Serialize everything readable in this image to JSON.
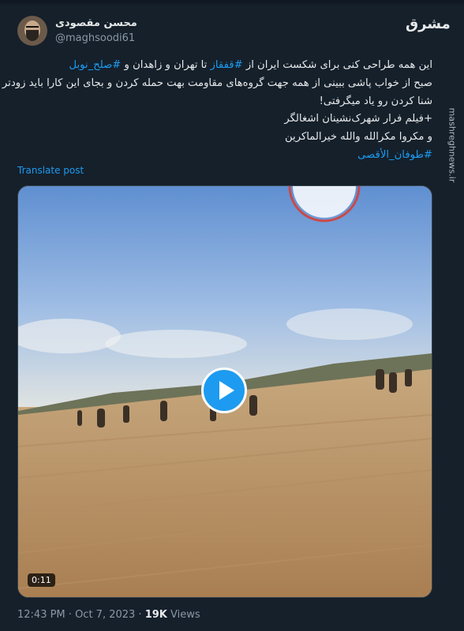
{
  "author": {
    "name": "محسن مقصودی",
    "handle": "@maghsoodi61"
  },
  "watermark": {
    "logo_text": "مشرق",
    "site": "mashreghnews.ir"
  },
  "post": {
    "line1_prefix": "این همه طراحی کنی برای شکست ایران از ",
    "line1_tag1": "#قفقاز",
    "line1_mid": " تا تهران و زاهدان و ",
    "line1_tag2": "#صلح_نوبل",
    "line2": "صبح از خواب پاشی ببینی از همه جهت گروه‌های مقاومت بهت حمله کردن و بجای این کارا باید زودتر",
    "line3": "شنا کردن رو یاد میگرفتی!",
    "line4": "+فیلم فرار شهرک‌نشینان اشغالگر",
    "line5": "و مکروا مکرالله والله خیرالماکرین",
    "tag_line": "#طوفان_الأقصی"
  },
  "translate_label": "Translate post",
  "video": {
    "duration": "0:11",
    "play_icon": "play-icon"
  },
  "meta": {
    "time": "12:43 PM",
    "separator": " · ",
    "date": "Oct 7, 2023",
    "views_count": "19K",
    "views_label": " Views"
  },
  "colors": {
    "background": "#15202b",
    "accent": "#1d9bf0",
    "muted": "#8b98a5",
    "text": "#e7e9ea"
  }
}
